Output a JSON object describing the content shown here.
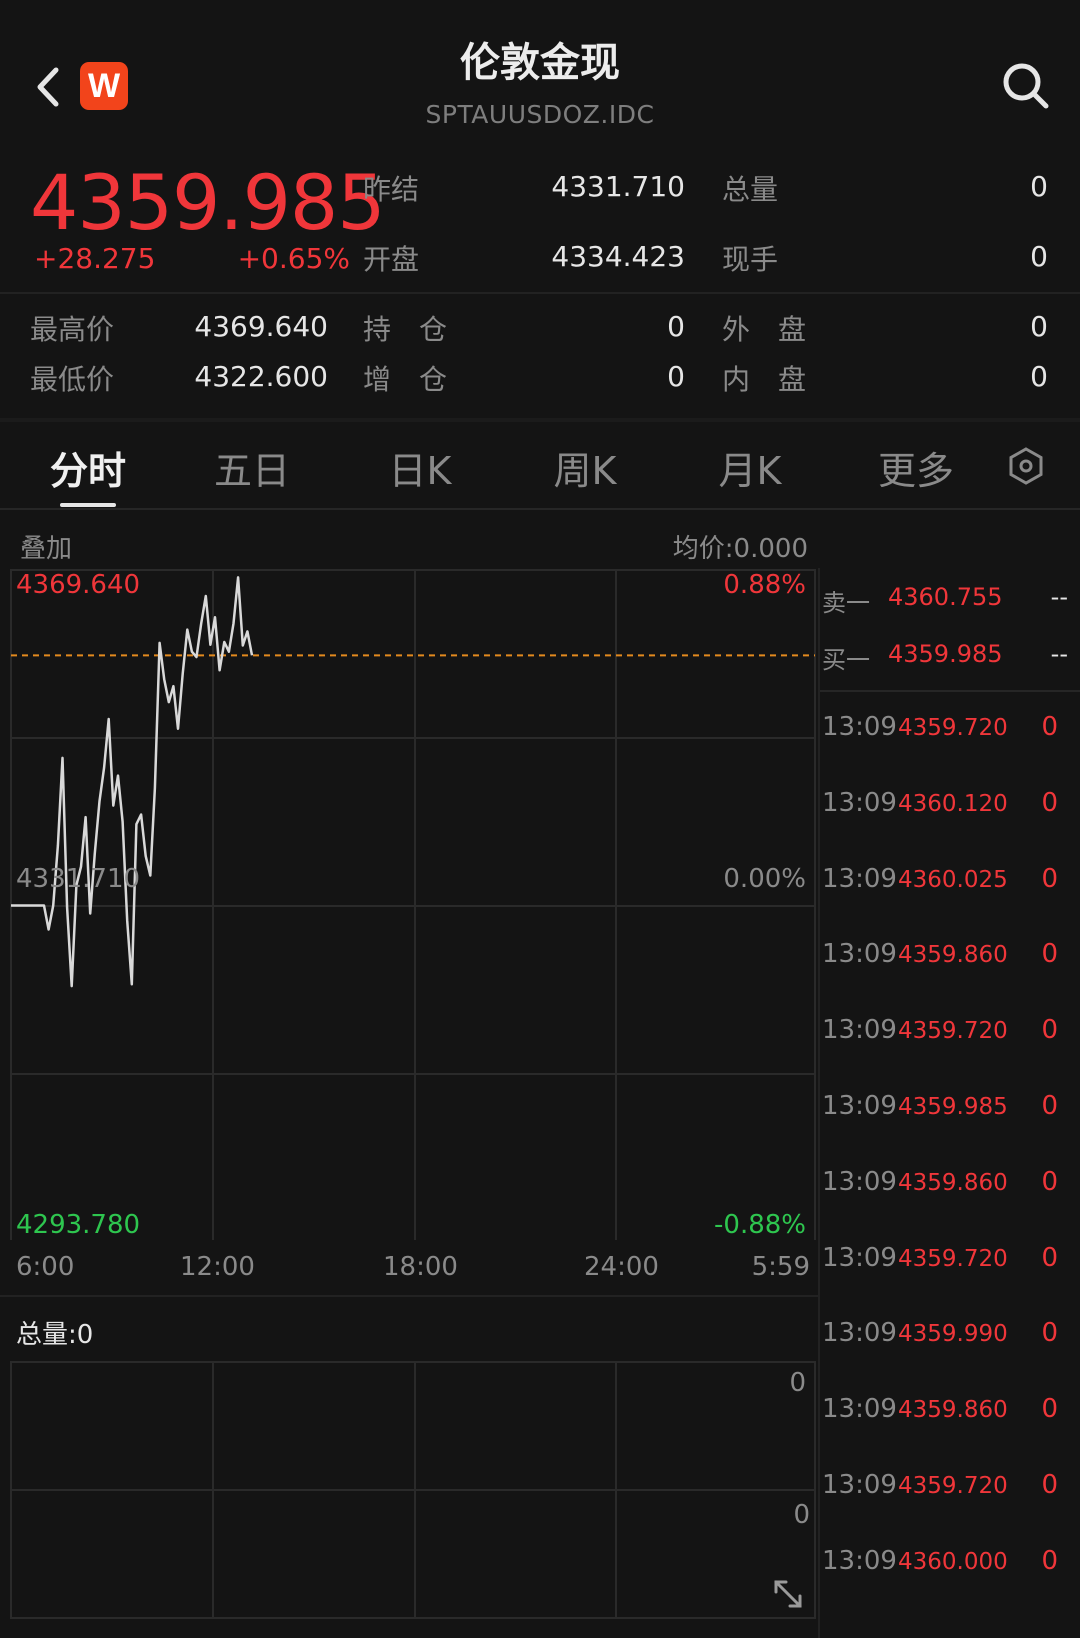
{
  "header": {
    "title": "伦敦金现",
    "code": "SPTAUUSDOZ.IDC",
    "logo_letter": "W"
  },
  "quote": {
    "last_price": "4359.985",
    "change": "+28.275",
    "change_pct": "+0.65%",
    "fields": [
      {
        "label": "昨结",
        "value": "4331.710"
      },
      {
        "label": "总量",
        "value": "0"
      },
      {
        "label": "开盘",
        "value": "4334.423"
      },
      {
        "label": "现手",
        "value": "0"
      },
      {
        "label": "最高价",
        "value": "4369.640"
      },
      {
        "label": "持　仓",
        "value": "0"
      },
      {
        "label": "外　盘",
        "value": "0"
      },
      {
        "label": "最低价",
        "value": "4322.600"
      },
      {
        "label": "增　仓",
        "value": "0"
      },
      {
        "label": "内　盘",
        "value": "0"
      }
    ]
  },
  "tabs": [
    "分时",
    "五日",
    "日K",
    "周K",
    "月K",
    "更多"
  ],
  "chart": {
    "overlay_label": "叠加",
    "avg_label": "均价:0.000",
    "high_price": "4369.640",
    "high_pct": "0.88%",
    "base_price": "4331.710",
    "base_pct": "0.00%",
    "low_price": "4293.780",
    "low_pct": "-0.88%",
    "time_labels": [
      "6:00",
      "12:00",
      "18:00",
      "24:00",
      "5:59"
    ],
    "volume_label": "总量:0",
    "volume_axis_top": "0",
    "volume_axis_mid": "0"
  },
  "chart_data": {
    "type": "line",
    "title": "",
    "xlabel": "",
    "ylabel": "",
    "ylim": [
      4293.78,
      4369.64
    ],
    "x_ticks": [
      "6:00",
      "12:00",
      "18:00",
      "24:00",
      "5:59"
    ],
    "reference_line": 4359.985,
    "series": [
      {
        "values": [
          4331.71,
          4331.71,
          4329.0,
          4331.7,
          4338.5,
          4348.4,
          4331.5,
          4322.6,
          4334.0,
          4336.1,
          4341.7,
          4330.8,
          4337.6,
          4343.5,
          4347.3,
          4352.8,
          4343.0,
          4346.4,
          4341.2,
          4330.0,
          4322.8,
          4340.9,
          4342.0,
          4337.3,
          4335.1,
          4345.0,
          4361.4,
          4357.3,
          4354.7,
          4356.5,
          4351.7,
          4357.9,
          4362.9,
          4360.4,
          4359.8,
          4363.6,
          4366.7,
          4361.2,
          4364.3,
          4358.3,
          4361.5,
          4360.4,
          4363.6,
          4368.8,
          4361.1,
          4362.7,
          4360.0
        ]
      }
    ]
  },
  "orderbook": [
    {
      "label": "卖一",
      "price": "4360.755",
      "vol": "--"
    },
    {
      "label": "买一",
      "price": "4359.985",
      "vol": "--"
    }
  ],
  "ticks": [
    {
      "time": "13:09",
      "price": "4359.720",
      "vol": "0"
    },
    {
      "time": "13:09",
      "price": "4360.120",
      "vol": "0"
    },
    {
      "time": "13:09",
      "price": "4360.025",
      "vol": "0"
    },
    {
      "time": "13:09",
      "price": "4359.860",
      "vol": "0"
    },
    {
      "time": "13:09",
      "price": "4359.720",
      "vol": "0"
    },
    {
      "time": "13:09",
      "price": "4359.985",
      "vol": "0"
    },
    {
      "time": "13:09",
      "price": "4359.860",
      "vol": "0"
    },
    {
      "time": "13:09",
      "price": "4359.720",
      "vol": "0"
    },
    {
      "time": "13:09",
      "price": "4359.990",
      "vol": "0"
    },
    {
      "time": "13:09",
      "price": "4359.860",
      "vol": "0"
    },
    {
      "time": "13:09",
      "price": "4359.720",
      "vol": "0"
    },
    {
      "time": "13:09",
      "price": "4360.000",
      "vol": "0"
    }
  ],
  "colors": {
    "up": "#f0363a",
    "down": "#2ec64f",
    "line": "#d9d9d9",
    "ref": "#e38a1e"
  }
}
